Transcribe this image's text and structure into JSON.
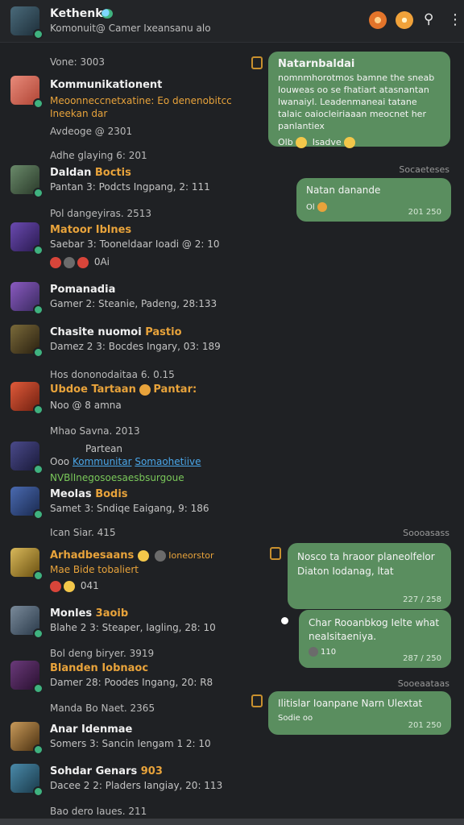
{
  "header": {
    "title": "Kethenka",
    "subtitle": "Komonuit@ Camer Ixeansanu alo"
  },
  "chats": [
    {
      "meta": "Vone: 3003"
    },
    {
      "name": "Kommunikationent",
      "line1": "Meoonneccnetxatine: Eo denenobitcc",
      "line2": "Ineekan dar",
      "meta2": "Avdeoge @ 2301"
    },
    {
      "meta": "Adhe glaying 6: 201"
    },
    {
      "name": "Daldan",
      "tag": "Boctis",
      "line1": "Pantan 3: Podcts Ingpang, 2: 111"
    },
    {
      "meta": "Pol dangeyiras. 2513"
    },
    {
      "name": "Matoor",
      "tag": "Iblnes",
      "line1": "Saebar 3: Tooneldaar Ioadi @ 2: 10",
      "line2": "0Ai"
    },
    {
      "name": "Pomanadia",
      "line1": "Gamer 2: Steanie, Padeng, 28:133"
    },
    {
      "name": "Chasite nuomoi",
      "tag": "Pastio",
      "line1": "Damez 2 3: Bocdes Ingary, 03: 189"
    },
    {
      "meta": "Hos dononodaitaa 6. 0.15"
    },
    {
      "name": "Ubdoe Tartaan",
      "tag": "Pantar:",
      "line1": "Noo @ 8 amna"
    },
    {
      "meta": "Mhao Savna. 2013"
    },
    {
      "name": "Partean",
      "line1": "Ooo",
      "link1": "Kommunitar",
      "link2": "Somaohetiive",
      "line2": "NVBlInegosoesaesbsurgoue"
    },
    {
      "name": "Meolas",
      "tag": "Bodis",
      "line1": "Samet 3: Sndiqe Eaigang, 9: 186"
    },
    {
      "meta": "Ican Siar. 415"
    },
    {
      "name": "Arhadbesaans",
      "tag": "Ioneorstor",
      "line1": "Mae",
      "tag2": "Bide tobaliert",
      "line2": "041"
    },
    {
      "name": "Monles",
      "tag": "3aoib",
      "line1": "Blahe 2 3: Steaper, Iagling, 28: 10"
    },
    {
      "meta": "Bol deng biryer. 3919"
    },
    {
      "name": "Blanden",
      "tag": "Iobnaoc",
      "line1": "Damer 28: Poodes Ingang, 20: R8"
    },
    {
      "meta": "Manda Bo Naet. 2365"
    },
    {
      "name": "Anar Idenmae",
      "line1": "Somers 3: Sancin Iengam 1 2: 10"
    },
    {
      "name": "Sohdar Genars",
      "tag": "903",
      "line1": "Dacee 2 2: Pladers Iangiay, 20: 113"
    },
    {
      "meta": "Bao dero Iaues. 211"
    }
  ],
  "messages": [
    {
      "title": "Natarnbaldai",
      "body": "nomnmhorotmos bamne the sneab Iouweas oo se fhatiart atasnantan lwanaiyl. Leadenmaneai tatane talaic oaiocleiriaaan meocnet her panlantiex",
      "footer": "Olb",
      "footer2": "Isadve"
    },
    {
      "label": "Socaeteses",
      "title": "Natan danande",
      "footer": "Ol",
      "time": "201 250"
    },
    {
      "label": "Soooasass",
      "body": "Nosco ta hraoor planeolfelor Diaton Iodanag, ltat",
      "time": "227 / 258"
    },
    {
      "body": "Char Rooanbkog Ielte what neaIsitaeniya.",
      "footer": "110",
      "time": "287 / 250"
    },
    {
      "label": "Sooeaataas",
      "body": "Ilitislar Ioanpane Narn Ulextat",
      "footer": "Sodie oo",
      "time": "201 250"
    }
  ],
  "colors": {
    "accent": "#e8a33b",
    "bubble": "#5a8e5f",
    "online": "#3fb27f",
    "background": "#1f2124"
  }
}
